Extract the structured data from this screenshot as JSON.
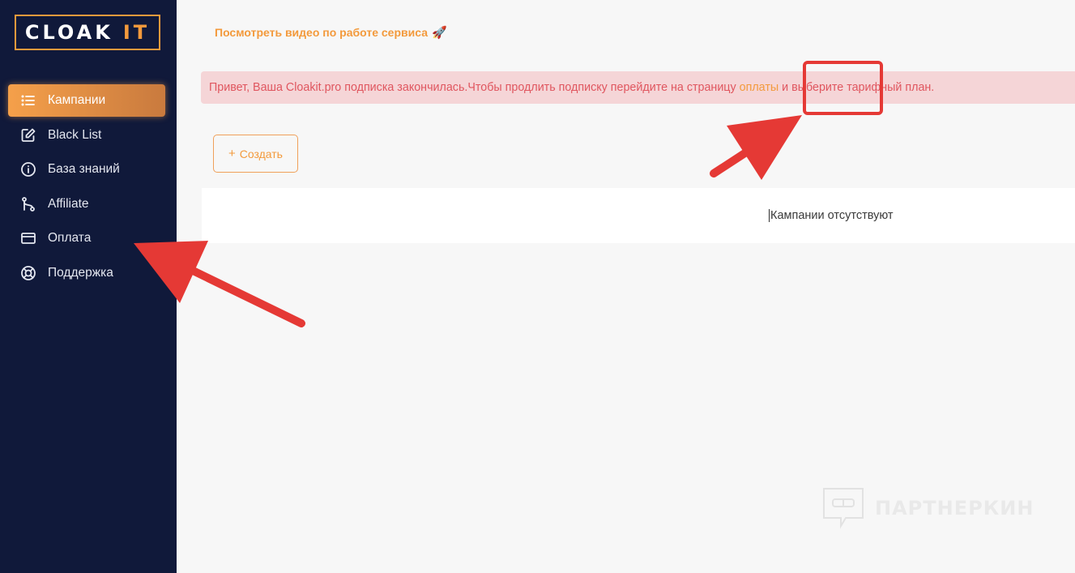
{
  "sidebar": {
    "logo": {
      "main": "CLOAK",
      "accent": "IT"
    },
    "items": [
      {
        "label": "Кампании",
        "icon": "list-icon",
        "active": true
      },
      {
        "label": "Black List",
        "icon": "edit-icon",
        "active": false
      },
      {
        "label": "База знаний",
        "icon": "info-icon",
        "active": false
      },
      {
        "label": "Affiliate",
        "icon": "git-branch-icon",
        "active": false
      },
      {
        "label": "Оплата",
        "icon": "credit-card-icon",
        "active": false
      },
      {
        "label": "Поддержка",
        "icon": "lifebuoy-icon",
        "active": false
      }
    ]
  },
  "header": {
    "video_link": "Посмотреть видео по работе сервиса",
    "video_icon": "rocket-icon"
  },
  "alert": {
    "text_before": "Привет, Ваша Cloakit.pro подписка закончилась.Чтобы продлить подписку перейдите на страницу",
    "link": "оплаты",
    "text_after": "и выберите тарифный план."
  },
  "main": {
    "create_button": "Создать",
    "empty_text": "Кампании отсутствуют"
  },
  "watermark": {
    "text": "ПАРТНЕРКИН"
  },
  "colors": {
    "sidebar_bg": "#10193a",
    "accent": "#f39a3c",
    "alert_bg": "#f5d5d7",
    "alert_text": "#e0565f",
    "annotation": "#e53935"
  }
}
